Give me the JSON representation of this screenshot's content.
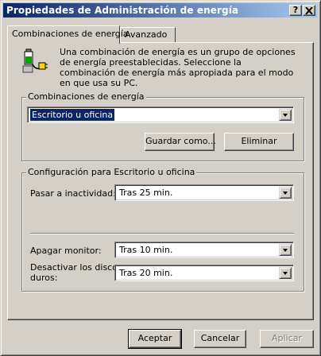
{
  "window": {
    "title": "Propiedades de Administración de energía",
    "help_button": "?",
    "close_button": "x"
  },
  "tabs": [
    {
      "label": "Combinaciones de energía",
      "active": true
    },
    {
      "label": "Avanzado",
      "active": false
    }
  ],
  "intro_text": "Una combinación de energía es un grupo de opciones de energía preestablecidas. Seleccione la combinación de energía más apropiada para el modo en que usa su PC.",
  "schemes_group": {
    "label": "Combinaciones de energía",
    "selected_scheme": "Escritorio u oficina",
    "save_as_button": "Guardar como...",
    "delete_button": "Eliminar"
  },
  "settings_group": {
    "label": "Configuración para Escritorio u oficina",
    "standby_label": "Pasar a inactividad:",
    "standby_value": "Tras 25 min.",
    "monitor_label": "Apagar monitor:",
    "monitor_value": "Tras 10 min.",
    "disks_label_line1": "Desactivar los discos",
    "disks_label_line2": "duros:",
    "disks_value": "Tras 20 min."
  },
  "footer": {
    "ok_button": "Aceptar",
    "cancel_button": "Cancelar",
    "apply_button": "Aplicar",
    "apply_enabled": false
  }
}
